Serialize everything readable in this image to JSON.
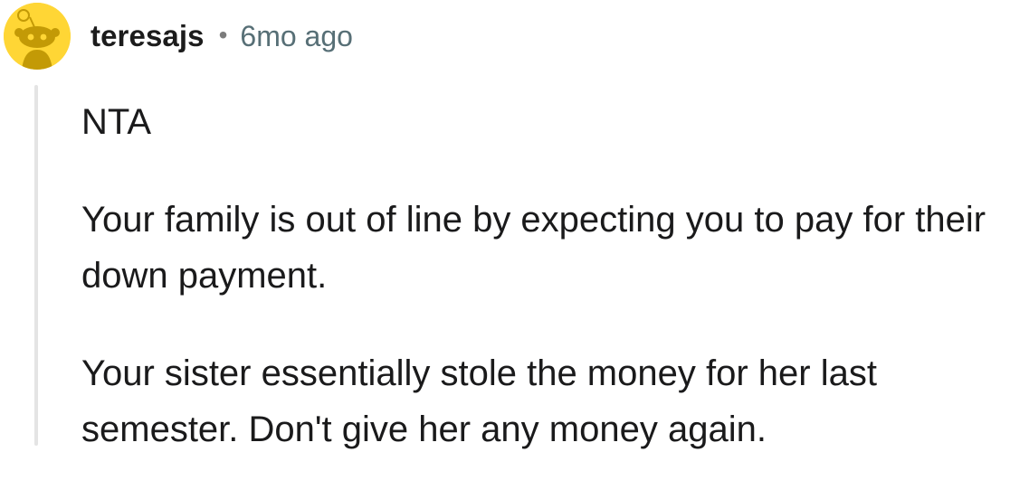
{
  "comment": {
    "avatar_icon": "reddit-snoo-avatar-icon",
    "avatar_color": "#ffd635",
    "username": "teresajs",
    "separator": "•",
    "age": "6mo ago",
    "paragraphs": [
      "NTA",
      "Your family is out of line by expecting you to pay for their down payment.",
      "Your sister essentially stole the money for her last semester. Don't give her any money again."
    ]
  }
}
